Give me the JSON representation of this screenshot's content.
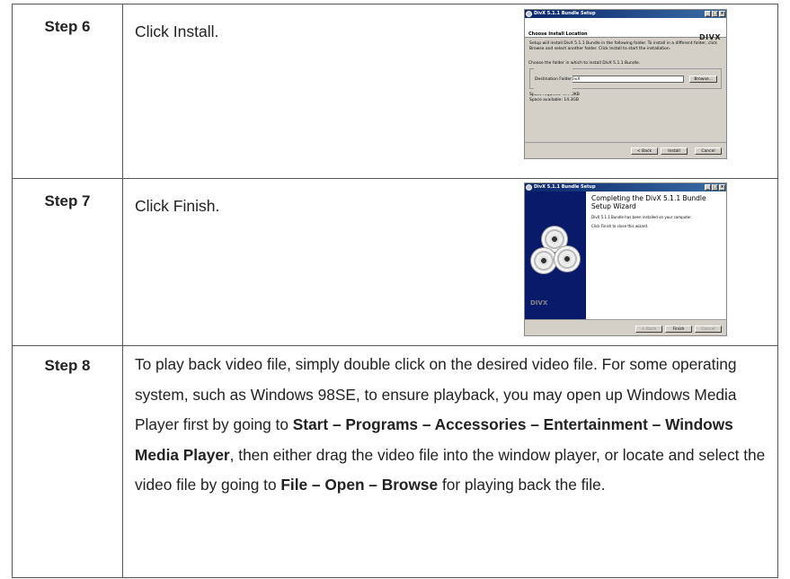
{
  "steps": [
    {
      "label": "Step 6",
      "instruction": "Click Install.",
      "dialog": {
        "title": "DivX 5.1.1 Bundle Setup",
        "header_title": "Choose Install Location",
        "header_subtitle": "Choose the folder in which to install DivX 5.1.1 Bundle.",
        "logo": "DIVX",
        "description": "Setup will install DivX 5.1.1 Bundle in the following folder. To install in a different folder, click Browse and select another folder. Click Install to start the installation.",
        "destination_legend": "Destination Folder",
        "destination_value": "C:\\Program Files\\DivX",
        "browse_label": "Browse...",
        "space_required": "Space required: 977.0KB",
        "space_available": "Space available: 14.3GB",
        "back_label": "< Back",
        "install_label": "Install",
        "cancel_label": "Cancel"
      }
    },
    {
      "label": "Step 7",
      "instruction": "Click Finish.",
      "dialog": {
        "title": "DivX 5.1.1 Bundle Setup",
        "heading": "Completing the DivX 5.1.1 Bundle Setup Wizard",
        "text1": "DivX 5.1.1 Bundle has been installed on your computer.",
        "text2": "Click Finish to close this wizard.",
        "side_logo": "DIVX",
        "back_label": "< Back",
        "finish_label": "Finish",
        "cancel_label": "Cancel"
      }
    },
    {
      "label": "Step 8",
      "text_a": "To play back video file, simply double click on the desired video file. For some operating system, such as Windows 98SE, to ensure playback, you may open up Windows Media Player first by going to ",
      "bold_a": "Start – Programs – Accessories – Entertainment – Windows Media Player",
      "text_b": ", then either drag the video file into the window player, or locate and select the video file by going to ",
      "bold_b": "File – Open – Browse",
      "text_c": " for playing back the file."
    }
  ]
}
